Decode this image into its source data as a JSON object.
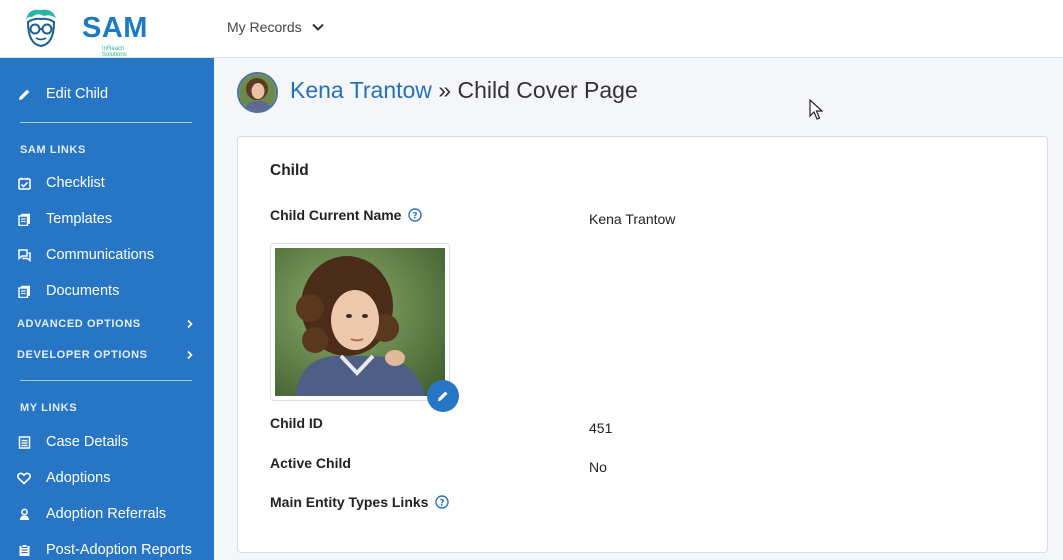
{
  "header": {
    "logo_text": "SAM",
    "logo_subtext": "InReach Solutions",
    "records_menu_label": "My Records",
    "records_menu_icon": "chevron-down-icon"
  },
  "sidebar": {
    "background": "#2776c6",
    "edit_child": {
      "label": "Edit Child",
      "icon": "pencil-icon"
    },
    "sam_links_heading": "SAM LINKS",
    "sam_links": [
      {
        "label": "Checklist",
        "icon": "checklist-icon"
      },
      {
        "label": "Templates",
        "icon": "templates-icon"
      },
      {
        "label": "Communications",
        "icon": "communications-icon"
      },
      {
        "label": "Documents",
        "icon": "documents-icon"
      }
    ],
    "advanced_options": "ADVANCED OPTIONS",
    "developer_options": "DEVELOPER OPTIONS",
    "my_links_heading": "MY LINKS",
    "my_links": [
      {
        "label": "Case Details",
        "icon": "case-details-icon"
      },
      {
        "label": "Adoptions",
        "icon": "heart-icon"
      },
      {
        "label": "Adoption Referrals",
        "icon": "referrals-icon"
      },
      {
        "label": "Post-Adoption Reports",
        "icon": "report-icon"
      }
    ]
  },
  "page": {
    "child_name_link": "Kena Trantow",
    "title_separator": " » ",
    "title_suffix": "Child Cover Page",
    "accent_color": "#2371bb"
  },
  "card": {
    "title": "Child",
    "fields": [
      {
        "label": "Child Current Name",
        "value": "Kena Trantow",
        "help": true
      },
      {
        "label": "Child ID",
        "value": "451",
        "help": false
      },
      {
        "label": "Active Child",
        "value": "No",
        "help": false
      },
      {
        "label": "Main Entity Types Links",
        "value": "",
        "help": true
      }
    ],
    "edit_photo_icon": "pencil-icon"
  }
}
